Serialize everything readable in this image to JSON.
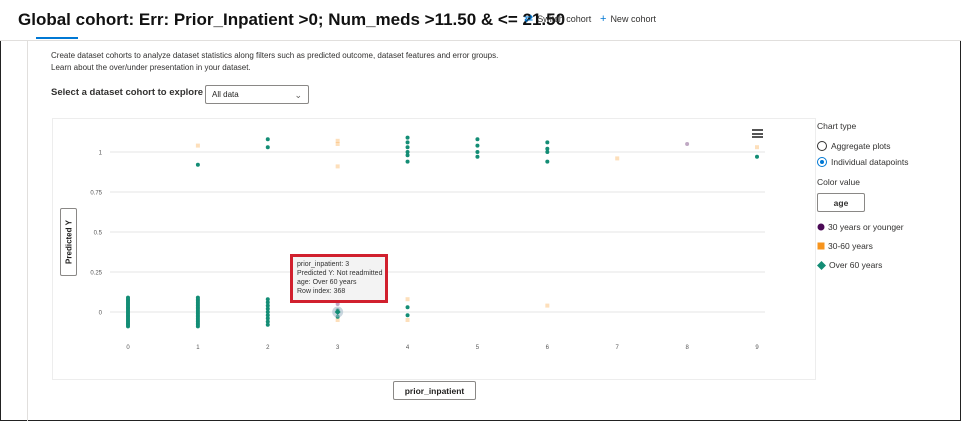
{
  "header": {
    "title": "Global cohort: Err: Prior_Inpatient >0; Num_meds >11.50 & <= 21.50",
    "switch_cohort": "Switch cohort",
    "new_cohort": "New cohort"
  },
  "description": "Create dataset cohorts to analyze dataset statistics along filters such as predicted outcome, dataset features and error groups. Learn about the over/under presentation in your dataset.",
  "cohort_select": {
    "label": "Select a dataset cohort to explore",
    "value": "All data"
  },
  "side_panel": {
    "chart_type_label": "Chart type",
    "options": [
      "Aggregate plots",
      "Individual datapoints"
    ],
    "selected_option": "Individual datapoints",
    "color_value_label": "Color value",
    "color_button": "age",
    "legend": [
      {
        "label": "30 years or younger",
        "color": "#4b0a56",
        "shape": "circle"
      },
      {
        "label": "30-60 years",
        "color": "#f7941d",
        "shape": "square"
      },
      {
        "label": "Over 60 years",
        "color": "#138d75",
        "shape": "diamond"
      }
    ]
  },
  "axis_buttons": {
    "y": "Predicted Y",
    "x": "prior_inpatient"
  },
  "tooltip": {
    "lines": [
      "prior_inpatient: 3",
      "Predicted Y: Not readmitted",
      "age: Over 60 years",
      "Row index: 368"
    ]
  },
  "chart_data": {
    "type": "scatter",
    "xlabel": "prior_inpatient",
    "ylabel": "Predicted Y",
    "x_ticks": [
      0,
      1,
      2,
      3,
      4,
      5,
      6,
      7,
      8,
      9
    ],
    "y_ticks": [
      0,
      0.25,
      0.5,
      0.75,
      1
    ],
    "y_tick_labels": [
      "0",
      "0.25",
      "0.5",
      "0.75",
      "1"
    ],
    "xlim": [
      0,
      9
    ],
    "ylim": [
      -0.15,
      1.15
    ],
    "grid": true,
    "series": [
      {
        "name": "Over 60 years",
        "color": "#138d75",
        "points": [
          [
            0,
            -0.09
          ],
          [
            0,
            -0.08
          ],
          [
            0,
            -0.07
          ],
          [
            0,
            -0.06
          ],
          [
            0,
            -0.05
          ],
          [
            0,
            -0.04
          ],
          [
            0,
            -0.03
          ],
          [
            0,
            -0.02
          ],
          [
            0,
            -0.01
          ],
          [
            0,
            0.0
          ],
          [
            0,
            0.01
          ],
          [
            0,
            0.02
          ],
          [
            0,
            0.03
          ],
          [
            0,
            0.04
          ],
          [
            0,
            0.05
          ],
          [
            0,
            0.06
          ],
          [
            0,
            0.07
          ],
          [
            0,
            0.08
          ],
          [
            0,
            0.09
          ],
          [
            1,
            -0.09
          ],
          [
            1,
            -0.08
          ],
          [
            1,
            -0.07
          ],
          [
            1,
            -0.06
          ],
          [
            1,
            -0.05
          ],
          [
            1,
            -0.04
          ],
          [
            1,
            -0.03
          ],
          [
            1,
            -0.02
          ],
          [
            1,
            -0.01
          ],
          [
            1,
            0.0
          ],
          [
            1,
            0.01
          ],
          [
            1,
            0.02
          ],
          [
            1,
            0.03
          ],
          [
            1,
            0.04
          ],
          [
            1,
            0.05
          ],
          [
            1,
            0.06
          ],
          [
            1,
            0.07
          ],
          [
            1,
            0.08
          ],
          [
            1,
            0.09
          ],
          [
            1,
            0.92
          ],
          [
            2,
            -0.08
          ],
          [
            2,
            -0.06
          ],
          [
            2,
            -0.04
          ],
          [
            2,
            -0.02
          ],
          [
            2,
            0.0
          ],
          [
            2,
            0.02
          ],
          [
            2,
            0.04
          ],
          [
            2,
            0.06
          ],
          [
            2,
            0.08
          ],
          [
            2,
            1.03
          ],
          [
            2,
            1.08
          ],
          [
            3,
            0.01
          ],
          [
            3,
            -0.03
          ],
          [
            4,
            -0.02
          ],
          [
            4,
            0.03
          ],
          [
            4,
            0.94
          ],
          [
            4,
            0.98
          ],
          [
            4,
            1.0
          ],
          [
            4,
            1.03
          ],
          [
            4,
            1.06
          ],
          [
            4,
            1.09
          ],
          [
            5,
            0.97
          ],
          [
            5,
            1.0
          ],
          [
            5,
            1.04
          ],
          [
            5,
            1.08
          ],
          [
            6,
            0.94
          ],
          [
            6,
            1.0
          ],
          [
            6,
            1.02
          ],
          [
            6,
            1.06
          ],
          [
            9,
            0.97
          ]
        ]
      },
      {
        "name": "30-60 years",
        "color": "#f7941d",
        "points": [
          [
            1,
            1.04
          ],
          [
            3,
            0.91
          ],
          [
            3,
            1.05
          ],
          [
            3,
            1.07
          ],
          [
            3,
            -0.05
          ],
          [
            4,
            -0.05
          ],
          [
            4,
            0.08
          ],
          [
            6,
            0.04
          ],
          [
            7,
            0.96
          ],
          [
            9,
            1.03
          ]
        ]
      },
      {
        "name": "30 years or younger",
        "color": "#4b0a56",
        "points": [
          [
            3,
            0.05
          ],
          [
            8,
            1.05
          ]
        ]
      }
    ]
  }
}
